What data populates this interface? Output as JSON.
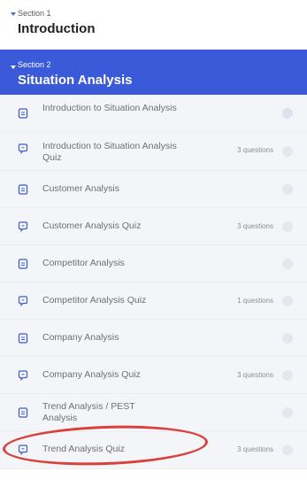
{
  "sections": [
    {
      "sub": "Section 1",
      "title": "Introduction"
    },
    {
      "sub": "Section 2",
      "title": "Situation Analysis"
    }
  ],
  "items": [
    {
      "type": "doc",
      "label": "Introduction to Situation Analysis",
      "meta": ""
    },
    {
      "type": "quiz",
      "label": "Introduction to Situation Analysis Quiz",
      "meta": "3 questions"
    },
    {
      "type": "doc",
      "label": "Customer Analysis",
      "meta": ""
    },
    {
      "type": "quiz",
      "label": "Customer Analysis Quiz",
      "meta": "3 questions"
    },
    {
      "type": "doc",
      "label": "Competitor Analysis",
      "meta": ""
    },
    {
      "type": "quiz",
      "label": "Competitor Analysis Quiz",
      "meta": "1 questions"
    },
    {
      "type": "doc",
      "label": "Company Analysis",
      "meta": ""
    },
    {
      "type": "quiz",
      "label": "Company Analysis Quiz",
      "meta": "3 questions"
    },
    {
      "type": "doc",
      "label": "Trend Analysis / PEST Analysis",
      "meta": ""
    },
    {
      "type": "quiz",
      "label": "Trend Analysis Quiz",
      "meta": "3 questions"
    }
  ],
  "colors": {
    "accent": "#3a5ad9",
    "highlight": "#d9413d"
  },
  "icons": {
    "doc": "document-icon",
    "quiz": "quiz-bubble-icon"
  }
}
